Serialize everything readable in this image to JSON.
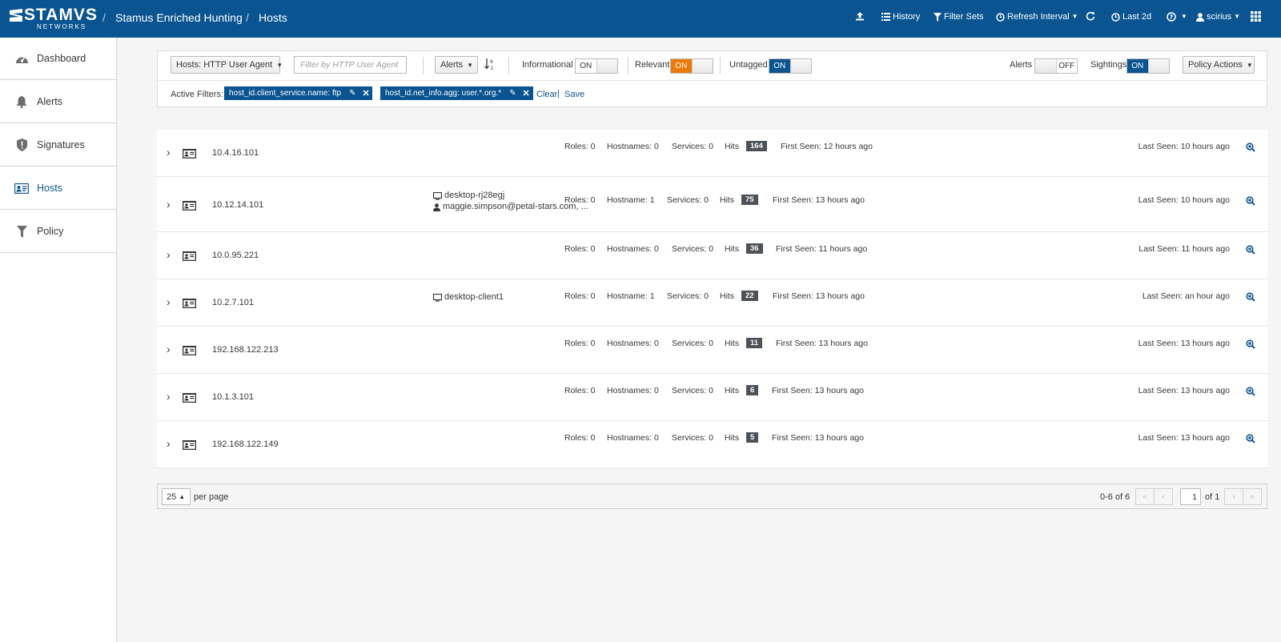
{
  "brand": {
    "name": "STAMVS",
    "sub": "NETWORKS"
  },
  "breadcrumb": {
    "app": "Stamus Enriched Hunting",
    "page": "Hosts"
  },
  "topnav": {
    "history": "History",
    "filter_sets": "Filter Sets",
    "refresh_interval": "Refresh Interval",
    "time_range": "Last 2d",
    "user": "scirius"
  },
  "sidebar": {
    "items": [
      {
        "label": "Dashboard",
        "icon": "dashboard-icon"
      },
      {
        "label": "Alerts",
        "icon": "bell-icon"
      },
      {
        "label": "Signatures",
        "icon": "shield-icon"
      },
      {
        "label": "Hosts",
        "icon": "id-card-icon"
      },
      {
        "label": "Policy",
        "icon": "funnel-icon"
      }
    ]
  },
  "toolbar": {
    "field_select": "Hosts: HTTP User Agent",
    "filter_placeholder": "Filter by HTTP User Agent",
    "sort_select": "Alerts",
    "informational_label": "Informational",
    "informational_state": "ON",
    "relevant_label": "Relevant",
    "relevant_state": "ON",
    "untagged_label": "Untagged",
    "untagged_state": "ON",
    "alerts_label": "Alerts",
    "alerts_state": "OFF",
    "sightings_label": "Sightings",
    "sightings_state": "ON",
    "policy_actions": "Policy Actions"
  },
  "filters": {
    "label": "Active Filters:",
    "chips": [
      "host_id.client_service.name: ftp",
      "host_id.net_info.agg: user.*.org.*"
    ],
    "clear": "Clear",
    "save": "Save"
  },
  "hosts": [
    {
      "ip": "10.4.16.101",
      "hostname": "",
      "user": "",
      "roles": "Roles: 0",
      "hostnames": "Hostnames: 0",
      "services": "Services: 0",
      "hits_label": "Hits",
      "hits": "164",
      "first_seen": "First Seen: 12 hours ago",
      "last_seen": "Last Seen: 10 hours ago"
    },
    {
      "ip": "10.12.14.101",
      "hostname": "desktop-rj28egj",
      "user": "maggie.simpson@petal-stars.com, ...",
      "roles": "Roles: 0",
      "hostnames": "Hostname: 1",
      "services": "Services: 0",
      "hits_label": "Hits",
      "hits": "75",
      "first_seen": "First Seen: 13 hours ago",
      "last_seen": "Last Seen: 10 hours ago"
    },
    {
      "ip": "10.0.95.221",
      "hostname": "",
      "user": "",
      "roles": "Roles: 0",
      "hostnames": "Hostnames: 0",
      "services": "Services: 0",
      "hits_label": "Hits",
      "hits": "36",
      "first_seen": "First Seen: 11 hours ago",
      "last_seen": "Last Seen: 11 hours ago"
    },
    {
      "ip": "10.2.7.101",
      "hostname": "desktop-client1",
      "user": "",
      "roles": "Roles: 0",
      "hostnames": "Hostname: 1",
      "services": "Services: 0",
      "hits_label": "Hits",
      "hits": "22",
      "first_seen": "First Seen: 13 hours ago",
      "last_seen": "Last Seen: an hour ago"
    },
    {
      "ip": "192.168.122.213",
      "hostname": "",
      "user": "",
      "roles": "Roles: 0",
      "hostnames": "Hostnames: 0",
      "services": "Services: 0",
      "hits_label": "Hits",
      "hits": "11",
      "first_seen": "First Seen: 13 hours ago",
      "last_seen": "Last Seen: 13 hours ago"
    },
    {
      "ip": "10.1.3.101",
      "hostname": "",
      "user": "",
      "roles": "Roles: 0",
      "hostnames": "Hostnames: 0",
      "services": "Services: 0",
      "hits_label": "Hits",
      "hits": "6",
      "first_seen": "First Seen: 13 hours ago",
      "last_seen": "Last Seen: 13 hours ago"
    },
    {
      "ip": "192.168.122.149",
      "hostname": "",
      "user": "",
      "roles": "Roles: 0",
      "hostnames": "Hostnames: 0",
      "services": "Services: 0",
      "hits_label": "Hits",
      "hits": "5",
      "first_seen": "First Seen: 13 hours ago",
      "last_seen": "Last Seen: 13 hours ago"
    }
  ],
  "pagination": {
    "per_page_value": "25",
    "per_page_label": "per page",
    "range": "0-6 of 6",
    "page": "1",
    "of_pages": "of 1"
  },
  "colors": {
    "brand_blue": "#0a5591",
    "relevant_orange": "#ec7a08",
    "badge_grey": "#4d5258"
  }
}
